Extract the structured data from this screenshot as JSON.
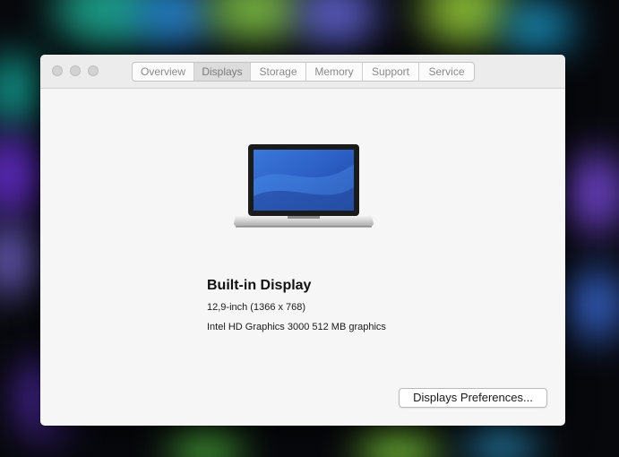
{
  "window": {
    "tabs": [
      {
        "label": "Overview",
        "selected": false
      },
      {
        "label": "Displays",
        "selected": true
      },
      {
        "label": "Storage",
        "selected": false
      },
      {
        "label": "Memory",
        "selected": false
      },
      {
        "label": "Support",
        "selected": false
      },
      {
        "label": "Service",
        "selected": false
      }
    ]
  },
  "display": {
    "title": "Built-in Display",
    "size": "12,9-inch (1366 x 768)",
    "graphics": "Intel HD Graphics 3000 512 MB graphics",
    "image_icon": "laptop-icon"
  },
  "actions": {
    "preferences_label": "Displays Preferences..."
  },
  "colors": {
    "window_background": "#f6f6f6",
    "titlebar_background": "#ececec",
    "desktop_background": "#07080c"
  }
}
